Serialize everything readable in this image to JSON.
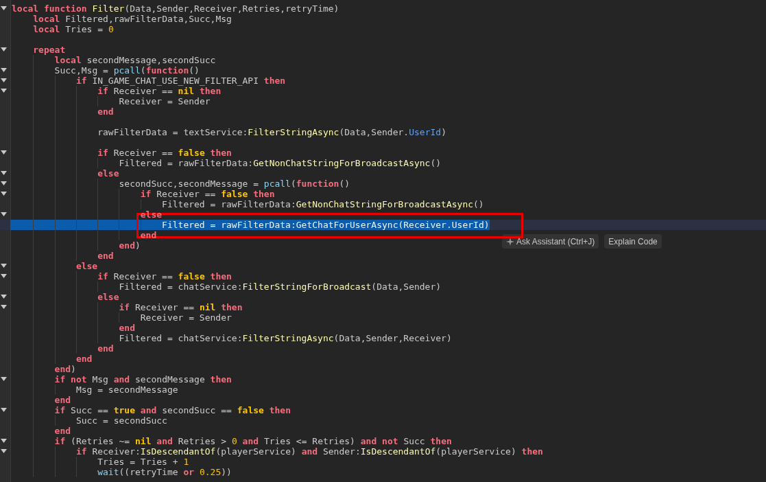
{
  "editor": {
    "lines": [
      {
        "selected": false,
        "expanded": true,
        "code": [
          {
            "text": "local function ",
            "kind": "keyword"
          },
          {
            "text": "Filter",
            "kind": "method"
          },
          {
            "text": "(Data,Sender,Receiver,Retries,retryTime)",
            "kind": "plain"
          }
        ],
        "children": [
          {
            "selected": false,
            "code": [
              {
                "text": "local ",
                "kind": "keyword"
              },
              {
                "text": "Filtered,rawFilterData,Succ,Msg",
                "kind": "plain"
              }
            ]
          },
          {
            "selected": false,
            "code": [
              {
                "text": "local ",
                "kind": "keyword"
              },
              {
                "text": "Tries = ",
                "kind": "plain"
              },
              {
                "text": "0",
                "kind": "number"
              }
            ]
          },
          {
            "selected": false
          },
          {
            "selected": false,
            "expanded": true,
            "code": [
              {
                "text": "repeat",
                "kind": "keyword"
              }
            ],
            "children": [
              {
                "selected": false,
                "code": [
                  {
                    "text": "local ",
                    "kind": "keyword"
                  },
                  {
                    "text": "secondMessage,secondSucc",
                    "kind": "plain"
                  }
                ]
              },
              {
                "selected": false,
                "expanded": true,
                "code": [
                  {
                    "text": "Succ,Msg = ",
                    "kind": "plain"
                  },
                  {
                    "text": "pcall",
                    "kind": "builtin"
                  },
                  {
                    "text": "(",
                    "kind": "plain"
                  },
                  {
                    "text": "function",
                    "kind": "keyword"
                  },
                  {
                    "text": "()",
                    "kind": "plain"
                  }
                ],
                "children": [
                  {
                    "selected": false,
                    "expanded": true,
                    "code": [
                      {
                        "text": "if ",
                        "kind": "keyword"
                      },
                      {
                        "text": "IN_GAME_CHAT_USE_NEW_FILTER_API ",
                        "kind": "plain"
                      },
                      {
                        "text": "then",
                        "kind": "keyword"
                      }
                    ],
                    "children": [
                      {
                        "selected": false,
                        "expanded": true,
                        "code": [
                          {
                            "text": "if ",
                            "kind": "keyword"
                          },
                          {
                            "text": "Receiver == ",
                            "kind": "plain"
                          },
                          {
                            "text": "nil ",
                            "kind": "literal"
                          },
                          {
                            "text": "then",
                            "kind": "keyword"
                          }
                        ],
                        "children": [
                          {
                            "selected": false,
                            "code": [
                              {
                                "text": "Receiver = Sender",
                                "kind": "plain"
                              }
                            ]
                          }
                        ]
                      },
                      {
                        "selected": false,
                        "code": [
                          {
                            "text": "end",
                            "kind": "keyword"
                          }
                        ]
                      },
                      {
                        "selected": false
                      },
                      {
                        "selected": false,
                        "code": [
                          {
                            "text": "rawFilterData = textService:",
                            "kind": "plain"
                          },
                          {
                            "text": "FilterStringAsync",
                            "kind": "method"
                          },
                          {
                            "text": "(Data,Sender.",
                            "kind": "plain"
                          },
                          {
                            "text": "UserId",
                            "kind": "property"
                          },
                          {
                            "text": ")",
                            "kind": "plain"
                          }
                        ]
                      },
                      {
                        "selected": false
                      },
                      {
                        "selected": false,
                        "expanded": true,
                        "code": [
                          {
                            "text": "if ",
                            "kind": "keyword"
                          },
                          {
                            "text": "Receiver == ",
                            "kind": "plain"
                          },
                          {
                            "text": "false ",
                            "kind": "literal"
                          },
                          {
                            "text": "then",
                            "kind": "keyword"
                          }
                        ],
                        "children": [
                          {
                            "selected": false,
                            "code": [
                              {
                                "text": "Filtered = rawFilterData:",
                                "kind": "plain"
                              },
                              {
                                "text": "GetNonChatStringForBroadcastAsync",
                                "kind": "method"
                              },
                              {
                                "text": "()",
                                "kind": "plain"
                              }
                            ]
                          }
                        ]
                      },
                      {
                        "selected": false,
                        "expanded": true,
                        "code": [
                          {
                            "text": "else",
                            "kind": "keyword"
                          }
                        ],
                        "children": [
                          {
                            "selected": false,
                            "expanded": true,
                            "code": [
                              {
                                "text": "secondSucc,secondMessage = ",
                                "kind": "plain"
                              },
                              {
                                "text": "pcall",
                                "kind": "builtin"
                              },
                              {
                                "text": "(",
                                "kind": "plain"
                              },
                              {
                                "text": "function",
                                "kind": "keyword"
                              },
                              {
                                "text": "()",
                                "kind": "plain"
                              }
                            ],
                            "children": [
                              {
                                "selected": false,
                                "expanded": true,
                                "code": [
                                  {
                                    "text": "if ",
                                    "kind": "keyword"
                                  },
                                  {
                                    "text": "Receiver == ",
                                    "kind": "plain"
                                  },
                                  {
                                    "text": "false ",
                                    "kind": "literal"
                                  },
                                  {
                                    "text": "then",
                                    "kind": "keyword"
                                  }
                                ],
                                "children": [
                                  {
                                    "selected": false,
                                    "code": [
                                      {
                                        "text": "Filtered = rawFilterData:",
                                        "kind": "plain"
                                      },
                                      {
                                        "text": "GetNonChatStringForBroadcastAsync",
                                        "kind": "method"
                                      },
                                      {
                                        "text": "()",
                                        "kind": "plain"
                                      }
                                    ]
                                  }
                                ]
                              },
                              {
                                "selected": false,
                                "expanded": true,
                                "code": [
                                  {
                                    "text": "else",
                                    "kind": "keyword"
                                  }
                                ],
                                "children": [
                                  {
                                    "selected": true,
                                    "code": [
                                      {
                                        "text": "Filtered = rawFilterData:",
                                        "kind": "plain"
                                      },
                                      {
                                        "text": "GetChatForUserAsync",
                                        "kind": "method"
                                      },
                                      {
                                        "text": "(Receiver.",
                                        "kind": "plain"
                                      },
                                      {
                                        "text": "UserId",
                                        "kind": "property"
                                      },
                                      {
                                        "text": ")",
                                        "kind": "plain"
                                      }
                                    ]
                                  }
                                ]
                              },
                              {
                                "selected": false,
                                "code": [
                                  {
                                    "text": "end",
                                    "kind": "keyword"
                                  }
                                ]
                              }
                            ]
                          },
                          {
                            "selected": false,
                            "code": [
                              {
                                "text": "end",
                                "kind": "keyword"
                              },
                              {
                                "text": ")",
                                "kind": "plain"
                              }
                            ]
                          }
                        ]
                      },
                      {
                        "selected": false,
                        "code": [
                          {
                            "text": "end",
                            "kind": "keyword"
                          }
                        ]
                      }
                    ]
                  },
                  {
                    "selected": false,
                    "expanded": true,
                    "code": [
                      {
                        "text": "else",
                        "kind": "keyword"
                      }
                    ],
                    "children": [
                      {
                        "selected": false,
                        "expanded": true,
                        "code": [
                          {
                            "text": "if ",
                            "kind": "keyword"
                          },
                          {
                            "text": "Receiver == ",
                            "kind": "plain"
                          },
                          {
                            "text": "false ",
                            "kind": "literal"
                          },
                          {
                            "text": "then",
                            "kind": "keyword"
                          }
                        ],
                        "children": [
                          {
                            "selected": false,
                            "code": [
                              {
                                "text": "Filtered = chatService:",
                                "kind": "plain"
                              },
                              {
                                "text": "FilterStringForBroadcast",
                                "kind": "method"
                              },
                              {
                                "text": "(Data,Sender)",
                                "kind": "plain"
                              }
                            ]
                          }
                        ]
                      },
                      {
                        "selected": false,
                        "expanded": true,
                        "code": [
                          {
                            "text": "else",
                            "kind": "keyword"
                          }
                        ],
                        "children": [
                          {
                            "selected": false,
                            "expanded": true,
                            "code": [
                              {
                                "text": "if ",
                                "kind": "keyword"
                              },
                              {
                                "text": "Receiver == ",
                                "kind": "plain"
                              },
                              {
                                "text": "nil ",
                                "kind": "literal"
                              },
                              {
                                "text": "then",
                                "kind": "keyword"
                              }
                            ],
                            "children": [
                              {
                                "selected": false,
                                "code": [
                                  {
                                    "text": "Receiver = Sender",
                                    "kind": "plain"
                                  }
                                ]
                              }
                            ]
                          },
                          {
                            "selected": false,
                            "code": [
                              {
                                "text": "end",
                                "kind": "keyword"
                              }
                            ]
                          },
                          {
                            "selected": false,
                            "code": [
                              {
                                "text": "Filtered = chatService:",
                                "kind": "plain"
                              },
                              {
                                "text": "FilterStringAsync",
                                "kind": "method"
                              },
                              {
                                "text": "(Data,Sender,Receiver)",
                                "kind": "plain"
                              }
                            ]
                          }
                        ]
                      },
                      {
                        "selected": false,
                        "code": [
                          {
                            "text": "end",
                            "kind": "keyword"
                          }
                        ]
                      }
                    ]
                  },
                  {
                    "selected": false,
                    "code": [
                      {
                        "text": "end",
                        "kind": "keyword"
                      }
                    ]
                  }
                ]
              },
              {
                "selected": false,
                "code": [
                  {
                    "text": "end",
                    "kind": "keyword"
                  },
                  {
                    "text": ")",
                    "kind": "plain"
                  }
                ]
              },
              {
                "selected": false,
                "expanded": true,
                "code": [
                  {
                    "text": "if not ",
                    "kind": "keyword"
                  },
                  {
                    "text": "Msg ",
                    "kind": "plain"
                  },
                  {
                    "text": "and ",
                    "kind": "keyword"
                  },
                  {
                    "text": "secondMessage ",
                    "kind": "plain"
                  },
                  {
                    "text": "then",
                    "kind": "keyword"
                  }
                ],
                "children": [
                  {
                    "selected": false,
                    "code": [
                      {
                        "text": "Msg = secondMessage",
                        "kind": "plain"
                      }
                    ]
                  }
                ]
              },
              {
                "selected": false,
                "code": [
                  {
                    "text": "end",
                    "kind": "keyword"
                  }
                ]
              },
              {
                "selected": false,
                "expanded": true,
                "code": [
                  {
                    "text": "if ",
                    "kind": "keyword"
                  },
                  {
                    "text": "Succ == ",
                    "kind": "plain"
                  },
                  {
                    "text": "true ",
                    "kind": "literal"
                  },
                  {
                    "text": "and ",
                    "kind": "keyword"
                  },
                  {
                    "text": "secondSucc == ",
                    "kind": "plain"
                  },
                  {
                    "text": "false ",
                    "kind": "literal"
                  },
                  {
                    "text": "then",
                    "kind": "keyword"
                  }
                ],
                "children": [
                  {
                    "selected": false,
                    "code": [
                      {
                        "text": "Succ = secondSucc",
                        "kind": "plain"
                      }
                    ]
                  }
                ]
              },
              {
                "selected": false,
                "code": [
                  {
                    "text": "end",
                    "kind": "keyword"
                  }
                ]
              },
              {
                "selected": false,
                "expanded": true,
                "code": [
                  {
                    "text": "if ",
                    "kind": "keyword"
                  },
                  {
                    "text": "(Retries ~= ",
                    "kind": "plain"
                  },
                  {
                    "text": "nil ",
                    "kind": "literal"
                  },
                  {
                    "text": "and ",
                    "kind": "keyword"
                  },
                  {
                    "text": "Retries > ",
                    "kind": "plain"
                  },
                  {
                    "text": "0 ",
                    "kind": "number"
                  },
                  {
                    "text": "and ",
                    "kind": "keyword"
                  },
                  {
                    "text": "Tries <= Retries) ",
                    "kind": "plain"
                  },
                  {
                    "text": "and not ",
                    "kind": "keyword"
                  },
                  {
                    "text": "Succ ",
                    "kind": "plain"
                  },
                  {
                    "text": "then",
                    "kind": "keyword"
                  }
                ],
                "children": [
                  {
                    "selected": false,
                    "expanded": true,
                    "code": [
                      {
                        "text": "if ",
                        "kind": "keyword"
                      },
                      {
                        "text": "Receiver:",
                        "kind": "plain"
                      },
                      {
                        "text": "IsDescendantOf",
                        "kind": "method"
                      },
                      {
                        "text": "(playerService) ",
                        "kind": "plain"
                      },
                      {
                        "text": "and ",
                        "kind": "keyword"
                      },
                      {
                        "text": "Sender:",
                        "kind": "plain"
                      },
                      {
                        "text": "IsDescendantOf",
                        "kind": "method"
                      },
                      {
                        "text": "(playerService) ",
                        "kind": "plain"
                      },
                      {
                        "text": "then",
                        "kind": "keyword"
                      }
                    ],
                    "children": [
                      {
                        "selected": false,
                        "code": [
                          {
                            "text": "Tries = Tries + ",
                            "kind": "plain"
                          },
                          {
                            "text": "1",
                            "kind": "number"
                          }
                        ]
                      },
                      {
                        "selected": false,
                        "code": [
                          {
                            "text": "wait",
                            "kind": "builtin"
                          },
                          {
                            "text": "((retryTime ",
                            "kind": "plain"
                          },
                          {
                            "text": "or ",
                            "kind": "keyword"
                          },
                          {
                            "text": "0.25",
                            "kind": "number"
                          },
                          {
                            "text": "))",
                            "kind": "plain"
                          }
                        ]
                      }
                    ]
                  }
                ]
              }
            ]
          }
        ]
      }
    ]
  },
  "code_actions": [
    {
      "label": "Ask Assistant (Ctrl+J)",
      "kind": "assistant"
    },
    {
      "label": "Explain Code",
      "kind": "plain"
    }
  ]
}
